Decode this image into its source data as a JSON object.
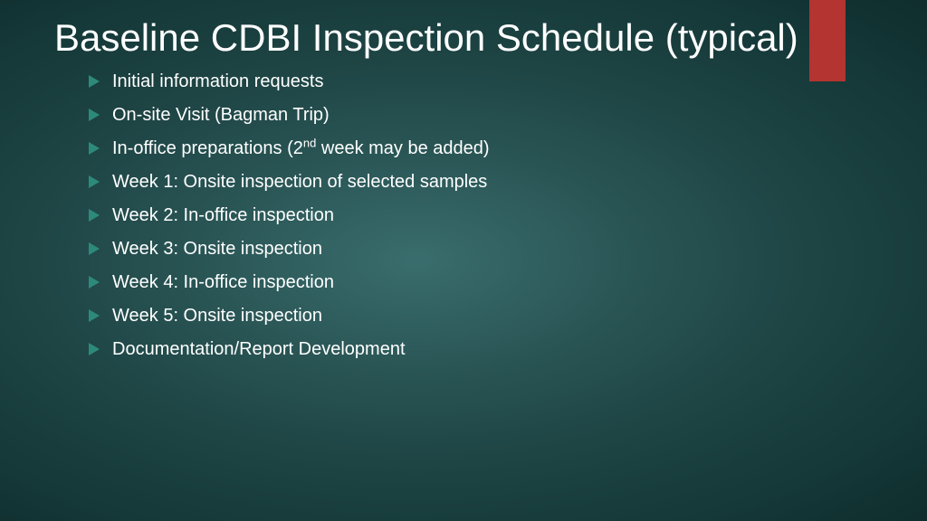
{
  "slide": {
    "title": "Baseline CDBI Inspection Schedule (typical)",
    "bullets": [
      {
        "pre": "Initial information requests"
      },
      {
        "pre": "On-site Visit (Bagman Trip)"
      },
      {
        "pre": "In-office preparations (2",
        "sup": "nd",
        "post": " week may be added)"
      },
      {
        "pre": "Week 1: Onsite inspection of selected samples"
      },
      {
        "pre": "Week 2: In-office inspection"
      },
      {
        "pre": "Week 3: Onsite inspection"
      },
      {
        "pre": "Week 4: In-office inspection"
      },
      {
        "pre": "Week 5: Onsite inspection"
      },
      {
        "pre": "Documentation/Report Development"
      }
    ]
  },
  "colors": {
    "accent": "#b33430",
    "marker": "#2d8a7a"
  }
}
